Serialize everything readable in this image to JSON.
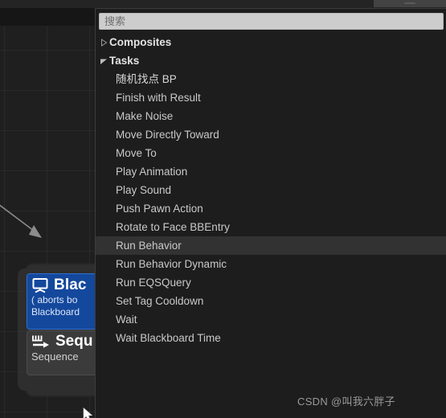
{
  "app": {
    "watermark": "CSDN @叫我六胖子"
  },
  "toolbar": {
    "strip_color": "#242424",
    "right_segment_color": "#434343"
  },
  "graph": {
    "background_color": "#1f1f1f",
    "nodes": [
      {
        "name": "blackboard-decorator",
        "icon": "blackboard-icon",
        "title": "Blac",
        "subtitle_line1": "( aborts bo",
        "subtitle_line2": "Blackboard",
        "accent_color": "#14489c"
      },
      {
        "name": "sequence-composite",
        "icon": "sequence-arrow-icon",
        "title": "Sequ",
        "subtitle_line1": "Sequence",
        "accent_color": "#3b3b3b"
      }
    ]
  },
  "popup": {
    "search": {
      "placeholder": "搜索",
      "value": ""
    },
    "groups": [
      {
        "label": "Composites",
        "expanded": false,
        "icon": "triangle-right-icon",
        "items": []
      },
      {
        "label": "Tasks",
        "expanded": true,
        "icon": "triangle-down-icon",
        "items": [
          {
            "label": "随机找点 BP",
            "selected": false,
            "cjk": true
          },
          {
            "label": "Finish with Result",
            "selected": false,
            "cjk": false
          },
          {
            "label": "Make Noise",
            "selected": false,
            "cjk": false
          },
          {
            "label": "Move Directly Toward",
            "selected": false,
            "cjk": false
          },
          {
            "label": "Move To",
            "selected": false,
            "cjk": false
          },
          {
            "label": "Play Animation",
            "selected": false,
            "cjk": false
          },
          {
            "label": "Play Sound",
            "selected": false,
            "cjk": false
          },
          {
            "label": "Push Pawn Action",
            "selected": false,
            "cjk": false
          },
          {
            "label": "Rotate to Face BBEntry",
            "selected": false,
            "cjk": false
          },
          {
            "label": "Run Behavior",
            "selected": true,
            "cjk": false
          },
          {
            "label": "Run Behavior Dynamic",
            "selected": false,
            "cjk": false
          },
          {
            "label": "Run EQSQuery",
            "selected": false,
            "cjk": false
          },
          {
            "label": "Set Tag Cooldown",
            "selected": false,
            "cjk": false
          },
          {
            "label": "Wait",
            "selected": false,
            "cjk": false
          },
          {
            "label": "Wait Blackboard Time",
            "selected": false,
            "cjk": false
          }
        ]
      }
    ],
    "colors": {
      "background": "#1d1d1d",
      "selected_row": "#323232",
      "text": "#c9c9c9",
      "heading_text": "#e3e3e3"
    }
  }
}
